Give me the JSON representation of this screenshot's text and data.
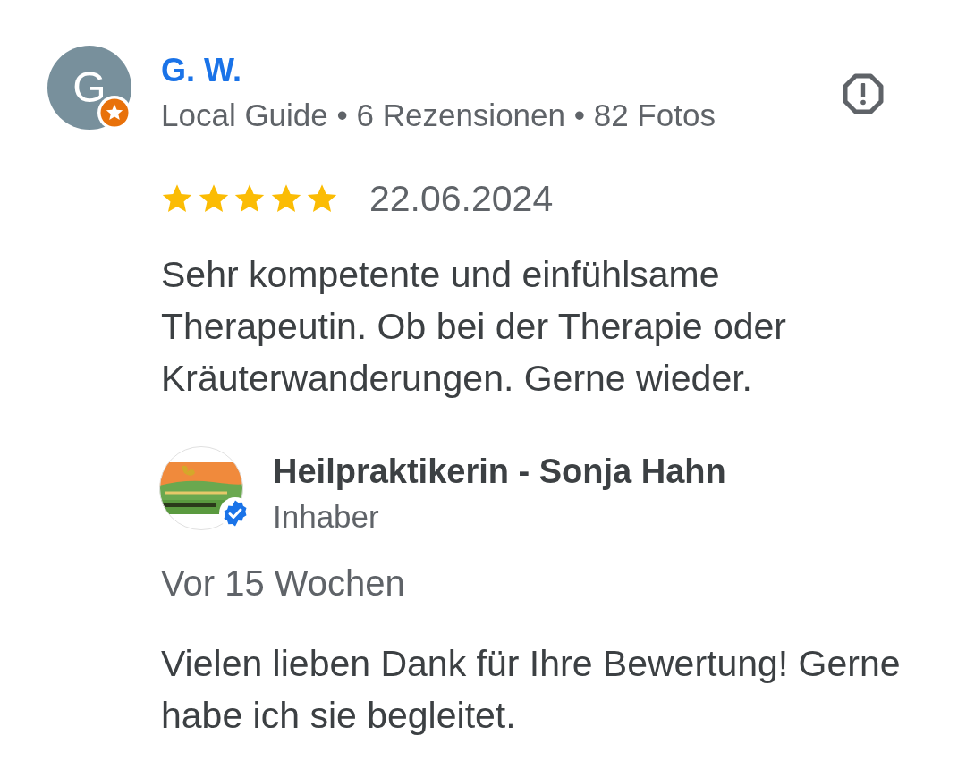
{
  "review": {
    "author": {
      "initial": "G",
      "name": "G. W.",
      "local_guide": true,
      "stats": "Local Guide • 6 Rezensionen • 82 Fotos"
    },
    "stars": 5,
    "date": "22.06.2024",
    "text": "Sehr kompetente und einfühlsame Therapeutin. Ob bei der Therapie oder Kräuterwanderungen. Gerne wieder."
  },
  "owner_reply": {
    "name": "Heilpraktikerin - Sonja Hahn",
    "role": "Inhaber",
    "verified": true,
    "time": "Vor 15 Wochen",
    "text": "Vielen lieben Dank für Ihre Bewertung! Gerne habe ich sie begleitet."
  }
}
